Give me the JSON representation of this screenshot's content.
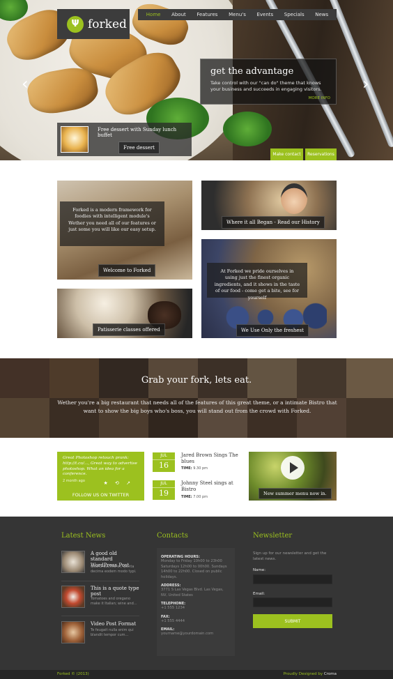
{
  "brand": {
    "name": "forked",
    "badge": "Ψ"
  },
  "nav": {
    "items": [
      {
        "label": "Home",
        "active": true
      },
      {
        "label": "About"
      },
      {
        "label": "Features"
      },
      {
        "label": "Menu's"
      },
      {
        "label": "Events"
      },
      {
        "label": "Specials"
      },
      {
        "label": "News"
      }
    ]
  },
  "slider": {
    "prev_glyph": "‹",
    "next_glyph": "›",
    "caption_title": "get the advantage",
    "caption_text": "Take control with our \"can do\" theme that knows your business and succeeds in engaging visitors.",
    "more_info": "MORE INFO",
    "dessert_text": "Free dessert with Sunday lunch buffet",
    "dessert_button": "Free dessert",
    "make_contact": "Make contact",
    "reservations": "Reservations"
  },
  "tiles": {
    "welcome_overlay": "Forked is a modern framework for foodies with intelligent module's Wether you need all of our features or just some you will like our easy setup.",
    "welcome_caption": "Welcome to Forked",
    "history_caption": "Where it all Began - Read our History",
    "fresh_overlay": "At Forked we pride ourselves in using just the finest organic ingredients, and it shows in the taste of our food - come get a bite, see for yourself",
    "fresh_caption": "We Use Only the freshest",
    "patisserie_caption": "Patisserie classes offered"
  },
  "band": {
    "title": "Grab your fork, lets eat.",
    "text": "Wether you're a big restaurant that needs all of the features of this great theme, or a intimate Bistro that want to show the big boys who's boss, you will stand out from the crowd with Forked."
  },
  "twitter": {
    "text": "Great Photoshop retouch prank: http://t.co/..., Great way to advertise photoshop. What an idea for a conference.",
    "time": "2 month ago",
    "icons": "★ ⟲ ↗",
    "follow": "FOLLOW US ON TWITTER"
  },
  "events": [
    {
      "month": "JUL",
      "day": "16",
      "title": "Jared Brown Sings The blues",
      "time_label": "TIME:",
      "time": "9.30 pm"
    },
    {
      "month": "JUL",
      "day": "19",
      "title": "Johnny Steel sings at Bistro",
      "time_label": "TIME:",
      "time": "7.00 pm"
    }
  ],
  "video": {
    "caption": "New summer menu now in."
  },
  "footer": {
    "news_heading": "Latest News",
    "contacts_heading": "Contacts",
    "newsletter_heading": "Newsletter",
    "news": [
      {
        "title": "A good old standard WordPress Post",
        "excerpt": "Quartz decima et, quinta decima eodem modo typi."
      },
      {
        "title": "This is a quote type post",
        "excerpt": "Tomatoes and oregano make it Italian; wine and..."
      },
      {
        "title": "Video Post Format",
        "excerpt": "Te feugait nulla enim qui blandit tempor cum..."
      }
    ],
    "contact": {
      "hours_label": "OPERATING HOURS:",
      "hours": "Monday to Friday 10h00 to 23h00 Saturdays 12h00 to 00h00. Sundays 14h00 to 22h00. Closed on public holidays.",
      "address_label": "ADDRESS:",
      "address": "3771 S Las Vegas Blvd. Las Vegas, NV, United States",
      "phone_label": "TELEPHONE:",
      "phone": "+1 555 1234",
      "fax_label": "FAX:",
      "fax": "+1 555 4444",
      "email_label": "EMAIL:",
      "email": "yourname@yourdomain.com"
    },
    "newsletter": {
      "intro": "Sign up for our newsletter and get the latest news.",
      "name_label": "Name:",
      "email_label": "Email:",
      "submit": "SUBMIT"
    }
  },
  "bottombar": {
    "copyright": "Forked © (2013)",
    "designed_by": "Proudly Designed by",
    "designer": "Croma"
  },
  "colors": {
    "accent": "#9cc11f",
    "dark": "#353535",
    "nav": "#3c3c3c"
  }
}
